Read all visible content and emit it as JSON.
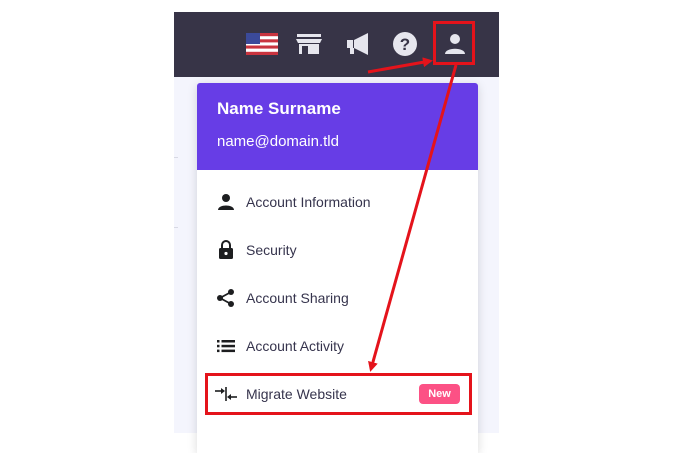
{
  "topbar": {
    "icons": [
      "us-flag-icon",
      "store-icon",
      "megaphone-icon",
      "help-icon",
      "user-icon"
    ]
  },
  "account": {
    "name": "Name Surname",
    "email": "name@domain.tld"
  },
  "menu": {
    "items": [
      {
        "label": "Account Information",
        "icon": "person-icon"
      },
      {
        "label": "Security",
        "icon": "lock-icon"
      },
      {
        "label": "Account Sharing",
        "icon": "share-icon"
      },
      {
        "label": "Account Activity",
        "icon": "list-icon"
      },
      {
        "label": "Migrate Website",
        "icon": "migrate-icon",
        "badge": "New"
      }
    ]
  },
  "colors": {
    "topbar": "#373447",
    "header": "#673de6",
    "badge": "#fc5185",
    "annotation": "#e4131b",
    "text": "#36344d"
  }
}
